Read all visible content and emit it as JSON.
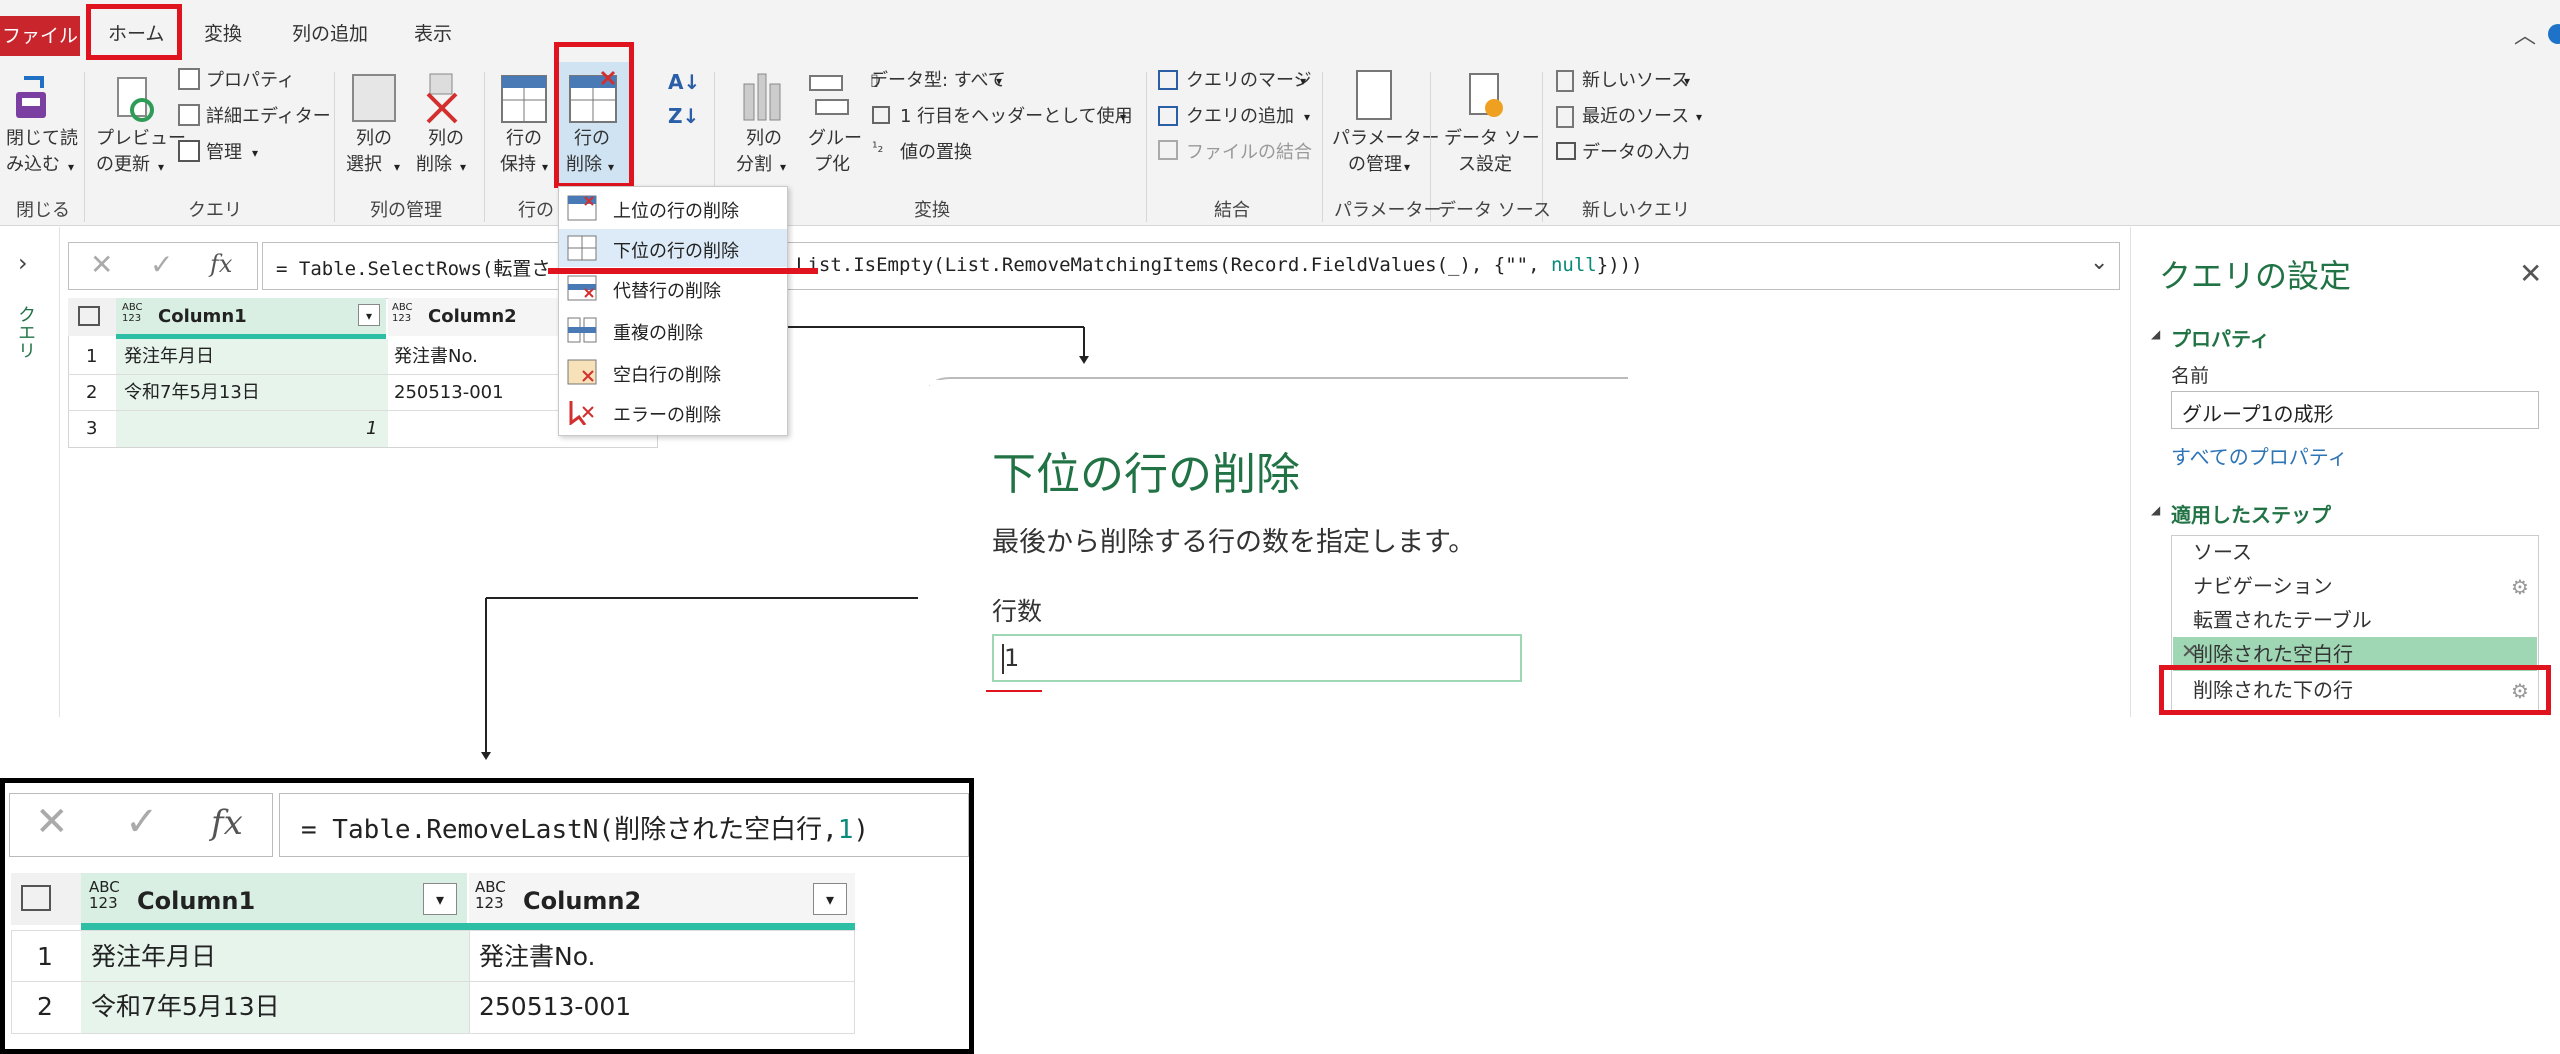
{
  "tabs": {
    "file": "ファイル",
    "home": "ホーム",
    "transform": "変換",
    "add_column": "列の追加",
    "view": "表示"
  },
  "ribbon": {
    "close_load_l1": "閉じて読",
    "close_load_l2": "み込む",
    "preview_l1": "プレビュー",
    "preview_l2": "の更新",
    "properties": "プロパティ",
    "adv_editor": "詳細エディター",
    "manage": "管理",
    "choose_cols_l1": "列の",
    "choose_cols_l2": "選択",
    "remove_cols_l1": "列の",
    "remove_cols_l2": "削除",
    "keep_rows_l1": "行の",
    "keep_rows_l2": "保持",
    "remove_rows_l1": "行の",
    "remove_rows_l2": "削除",
    "split_col_l1": "列の",
    "split_col_l2": "分割",
    "group_l1": "グルー",
    "group_l2": "プ化",
    "datatype": "データ型: すべて",
    "first_row_header": "1 行目をヘッダーとして使用",
    "replace_values": "値の置換",
    "merge_queries": "クエリのマージ",
    "append_queries": "クエリの追加",
    "combine_files": "ファイルの結合",
    "params_l1": "パラメーター",
    "params_l2": "の管理",
    "ds_l1": "データ ソー",
    "ds_l2": "ス設定",
    "new_source": "新しいソース",
    "recent_sources": "最近のソース",
    "enter_data": "データの入力",
    "groups": {
      "close": "閉じる",
      "query": "クエリ",
      "manage_cols": "列の管理",
      "reduce_rows": "行の",
      "transform": "変換",
      "combine": "結合",
      "params": "パラメーター",
      "data_sources": "データ ソース",
      "new_query": "新しいクエリ"
    }
  },
  "leftnav": {
    "queries": "クエリ"
  },
  "formula": {
    "prefix": "= Table.SelectRows(転置さ",
    "suffix": "List.IsEmpty(List.RemoveMatchingItems(Record.FieldValues(_), {\"\", ",
    "null": "null",
    "end": "})))"
  },
  "grid": {
    "col1": "Column1",
    "col2": "Column2",
    "type_top": "ABC",
    "type_bottom": "123",
    "rows": [
      {
        "n": "1",
        "c1": "発注年月日",
        "c2": "発注書No."
      },
      {
        "n": "2",
        "c1": "令和7年5月13日",
        "c2": "250513-001"
      },
      {
        "n": "3",
        "c1": "1",
        "c2": ""
      }
    ]
  },
  "menu": {
    "items": [
      "上位の行の削除",
      "下位の行の削除",
      "代替行の削除",
      "重複の削除",
      "空白行の削除",
      "エラーの削除"
    ]
  },
  "dialog": {
    "title": "下位の行の削除",
    "desc": "最後から削除する行の数を指定します。",
    "field_label": "行数",
    "field_value": "1"
  },
  "settings": {
    "title": "クエリの設定",
    "props_header": "プロパティ",
    "name_label": "名前",
    "name_value": "グループ1の成形",
    "all_props": "すべてのプロパティ",
    "steps_header": "適用したステップ",
    "steps": [
      "ソース",
      "ナビゲーション",
      "転置されたテーブル",
      "削除された空白行",
      "削除された下の行"
    ]
  },
  "result": {
    "formula_prefix": "= Table.RemoveLastN(削除された空白行,",
    "formula_num": "1",
    "formula_end": ")",
    "col1": "Column1",
    "col2": "Column2",
    "rows": [
      {
        "n": "1",
        "c1": "発注年月日",
        "c2": "発注書No."
      },
      {
        "n": "2",
        "c1": "令和7年5月13日",
        "c2": "250513-001"
      }
    ]
  },
  "colors": {
    "accent_green": "#217346",
    "grid_header": "#d9efe3",
    "teal_bar": "#2dbfa5",
    "red_highlight": "#e0141e",
    "file_tab": "#c8252c",
    "step_selected": "#9fd7b5",
    "link": "#2e75b6"
  }
}
